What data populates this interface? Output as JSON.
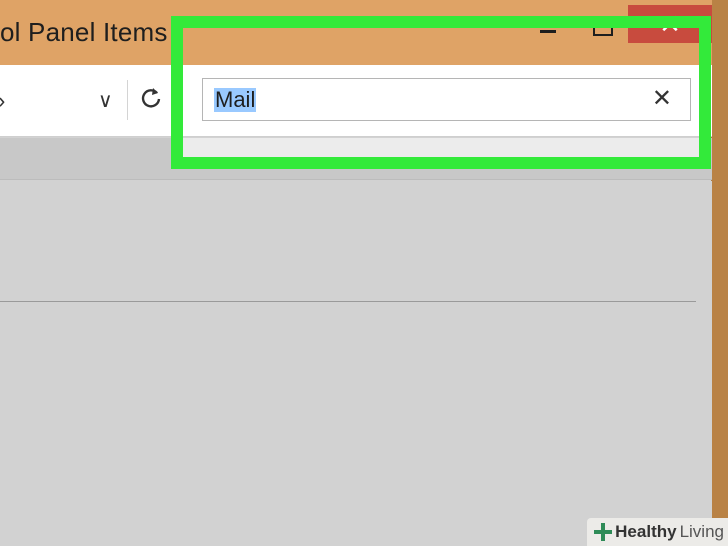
{
  "window": {
    "title": "ol Panel Items",
    "close_glyph": "✕"
  },
  "address_bar": {
    "back_glyph": "›",
    "dropdown_glyph": "∨"
  },
  "search": {
    "value": "Mail",
    "clear_glyph": "✕"
  },
  "watermark": {
    "brand_bold": "Healthy",
    "brand_light": "Living"
  },
  "colors": {
    "highlight": "#33ea3a",
    "titlebar": "#dfa366",
    "close_button": "#c84b3e",
    "selection": "#99c9ff"
  },
  "icons": [
    "minimize-icon",
    "maximize-icon",
    "close-icon",
    "back-arrow-icon",
    "chevron-down-icon",
    "refresh-icon",
    "clear-search-icon",
    "healthy-living-logo"
  ]
}
